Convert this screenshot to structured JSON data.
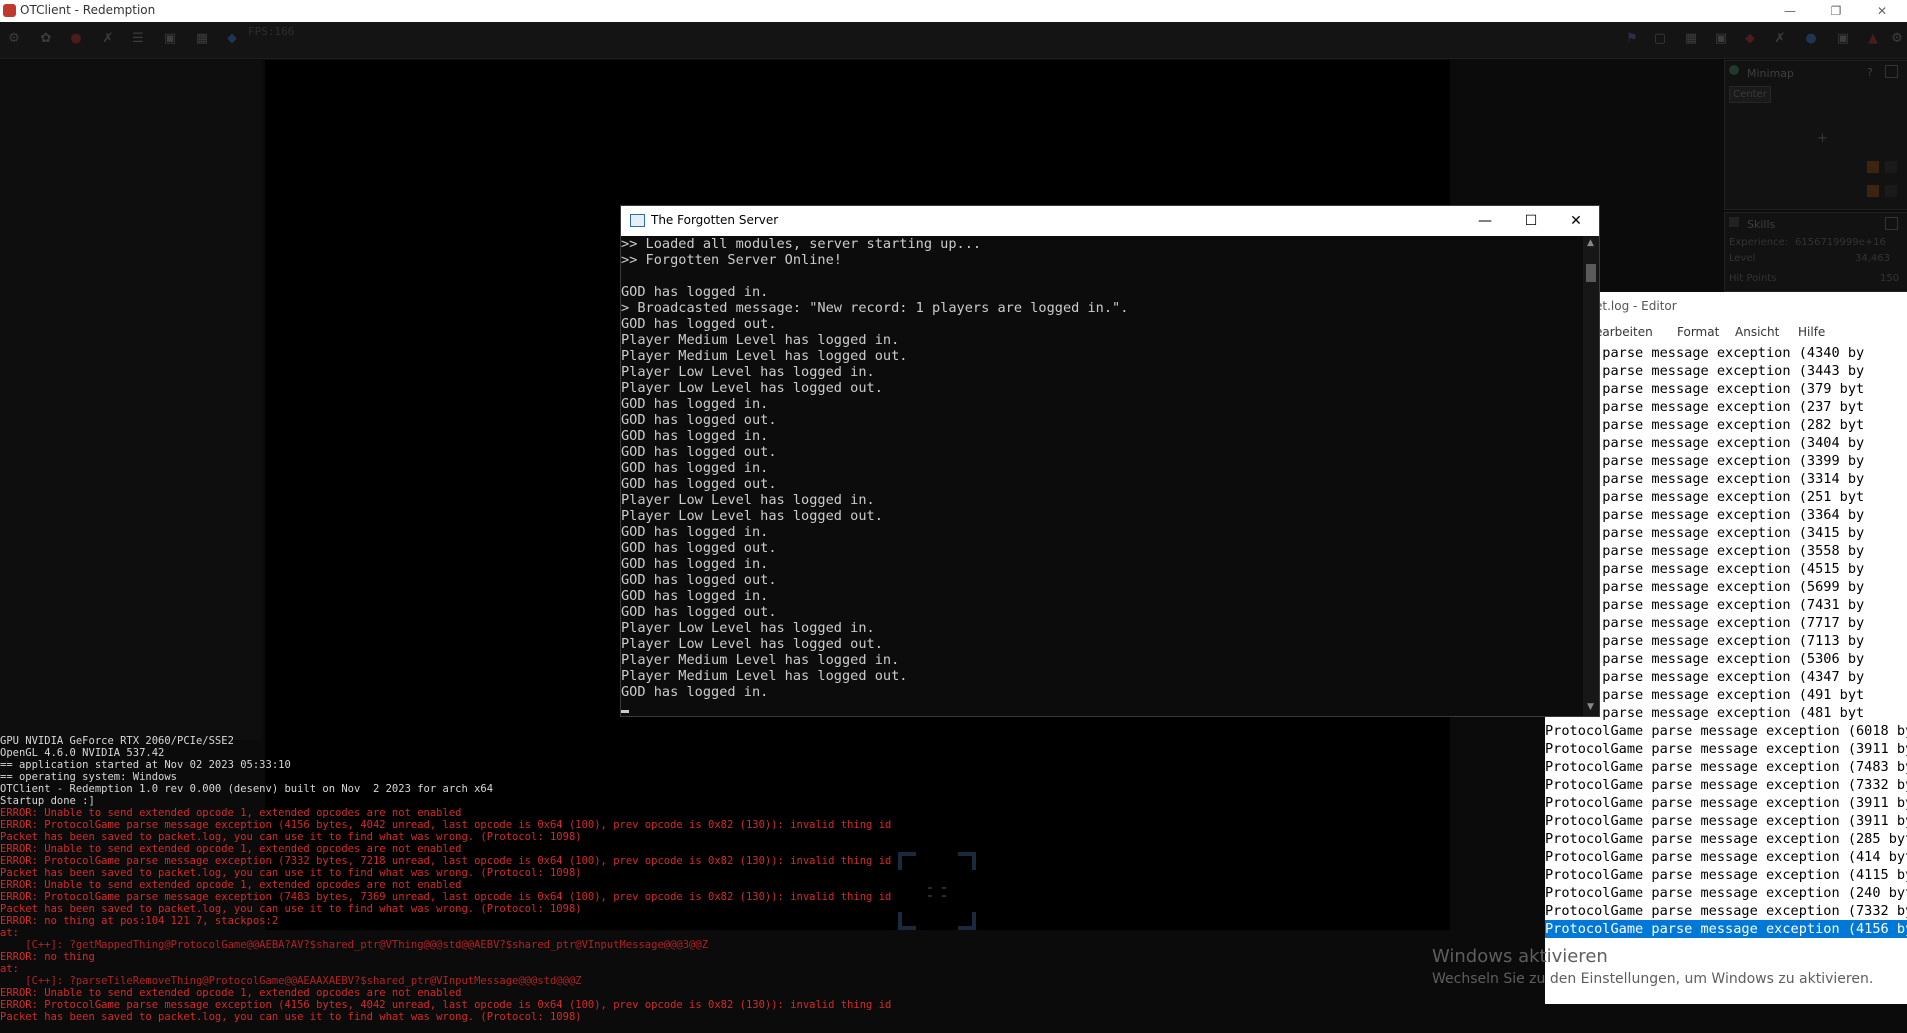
{
  "otclient": {
    "title": "OTClient - Redemption",
    "fps": "FPS:166",
    "minimap_title": "Minimap",
    "minimap_center": "Center",
    "skills_title": "Skills",
    "skills_experience": "Experience:",
    "skills_experience_value": "6156719999e+16",
    "skills_level": "Level",
    "skills_level_value": "34,463",
    "skills_hitpoints": "Hit Points",
    "skills_hitpoints_value": "150"
  },
  "console": {
    "lines": [
      {
        "t": "GPU NVIDIA GeForce RTX 2060/PCIe/SSE2",
        "k": "info"
      },
      {
        "t": "OpenGL 4.6.0 NVIDIA 537.42",
        "k": "info"
      },
      {
        "t": "== application started at Nov 02 2023 05:33:10",
        "k": "info"
      },
      {
        "t": "== operating system: Windows",
        "k": "info"
      },
      {
        "t": "OTClient - Redemption 1.0 rev 0.000 (desenv) built on Nov  2 2023 for arch x64",
        "k": "info"
      },
      {
        "t": "Startup done :]",
        "k": "info"
      },
      {
        "t": "ERROR: Unable to send extended opcode 1, extended opcodes are not enabled",
        "k": "err"
      },
      {
        "t": "ERROR: ProtocolGame parse message exception (4156 bytes, 4042 unread, last opcode is 0x64 (100), prev opcode is 0x82 (130)): invalid thing id",
        "k": "err"
      },
      {
        "t": "Packet has been saved to packet.log, you can use it to find what was wrong. (Protocol: 1098)",
        "k": "err"
      },
      {
        "t": "ERROR: Unable to send extended opcode 1, extended opcodes are not enabled",
        "k": "err"
      },
      {
        "t": "ERROR: ProtocolGame parse message exception (7332 bytes, 7218 unread, last opcode is 0x64 (100), prev opcode is 0x82 (130)): invalid thing id",
        "k": "err"
      },
      {
        "t": "Packet has been saved to packet.log, you can use it to find what was wrong. (Protocol: 1098)",
        "k": "err"
      },
      {
        "t": "ERROR: Unable to send extended opcode 1, extended opcodes are not enabled",
        "k": "err"
      },
      {
        "t": "ERROR: ProtocolGame parse message exception (7483 bytes, 7369 unread, last opcode is 0x64 (100), prev opcode is 0x82 (130)): invalid thing id",
        "k": "err"
      },
      {
        "t": "Packet has been saved to packet.log, you can use it to find what was wrong. (Protocol: 1098)",
        "k": "err"
      },
      {
        "t": "ERROR: no thing at pos:104 121 7, stackpos:2",
        "k": "err"
      },
      {
        "t": "at:",
        "k": "err"
      },
      {
        "t": "    [C++]: ?getMappedThing@ProtocolGame@@AEBA?AV?$shared_ptr@VThing@@@std@@AEBV?$shared_ptr@VInputMessage@@@3@@Z",
        "k": "trace"
      },
      {
        "t": "ERROR: no thing",
        "k": "err"
      },
      {
        "t": "at:",
        "k": "err"
      },
      {
        "t": "    [C++]: ?parseTileRemoveThing@ProtocolGame@@AEAAXAEBV?$shared_ptr@VInputMessage@@@std@@@Z",
        "k": "trace"
      },
      {
        "t": "ERROR: Unable to send extended opcode 1, extended opcodes are not enabled",
        "k": "err"
      },
      {
        "t": "ERROR: ProtocolGame parse message exception (4156 bytes, 4042 unread, last opcode is 0x64 (100), prev opcode is 0x82 (130)): invalid thing id",
        "k": "err"
      },
      {
        "t": "Packet has been saved to packet.log, you can use it to find what was wrong. (Protocol: 1098)",
        "k": "err"
      }
    ]
  },
  "tfs_window": {
    "title": "The Forgotten Server",
    "lines": [
      ">> Loaded all modules, server starting up...",
      ">> Forgotten Server Online!",
      "",
      "GOD has logged in.",
      "> Broadcasted message: \"New record: 1 players are logged in.\".",
      "GOD has logged out.",
      "Player Medium Level has logged in.",
      "Player Medium Level has logged out.",
      "Player Low Level has logged in.",
      "Player Low Level has logged out.",
      "GOD has logged in.",
      "GOD has logged out.",
      "GOD has logged in.",
      "GOD has logged out.",
      "GOD has logged in.",
      "GOD has logged out.",
      "Player Low Level has logged in.",
      "Player Low Level has logged out.",
      "GOD has logged in.",
      "GOD has logged out.",
      "GOD has logged in.",
      "GOD has logged out.",
      "GOD has logged in.",
      "GOD has logged out.",
      "Player Low Level has logged in.",
      "Player Low Level has logged out.",
      "Player Medium Level has logged in.",
      "Player Medium Level has logged out.",
      "GOD has logged in."
    ]
  },
  "editor": {
    "title": "et.log - Editor",
    "menu": [
      "earbeiten",
      "Format",
      "Ansicht",
      "Hilfe"
    ],
    "lines": [
      "olGame parse message exception (4340 by",
      "olGame parse message exception (3443 by",
      "olGame parse message exception (379 byt",
      "olGame parse message exception (237 byt",
      "olGame parse message exception (282 byt",
      "olGame parse message exception (3404 by",
      "olGame parse message exception (3399 by",
      "olGame parse message exception (3314 by",
      "olGame parse message exception (251 byt",
      "olGame parse message exception (3364 by",
      "olGame parse message exception (3415 by",
      "olGame parse message exception (3558 by",
      "olGame parse message exception (4515 by",
      "olGame parse message exception (5699 by",
      "olGame parse message exception (7431 by",
      "olGame parse message exception (7717 by",
      "olGame parse message exception (7113 by",
      "olGame parse message exception (5306 by",
      "olGame parse message exception (4347 by",
      "olGame parse message exception (491 byt",
      "olGame parse message exception (481 byt",
      "ProtocolGame parse message exception (6018 by",
      "ProtocolGame parse message exception (3911 by",
      "ProtocolGame parse message exception (7483 by",
      "ProtocolGame parse message exception (7332 by",
      "ProtocolGame parse message exception (3911 by",
      "ProtocolGame parse message exception (3911 by",
      "ProtocolGame parse message exception (285 byt",
      "ProtocolGame parse message exception (414 byt",
      "ProtocolGame parse message exception (4115 by",
      "ProtocolGame parse message exception (240 byt",
      "ProtocolGame parse message exception (7332 by",
      "ProtocolGame parse message exception (4156 by"
    ],
    "selected_index": 32
  },
  "watermark": {
    "title": "Windows aktivieren",
    "subtitle": "Wechseln Sie zu den Einstellungen, um Windows zu aktivieren."
  },
  "colors": {
    "error": "#d42a2a",
    "selection": "#0078d7"
  }
}
